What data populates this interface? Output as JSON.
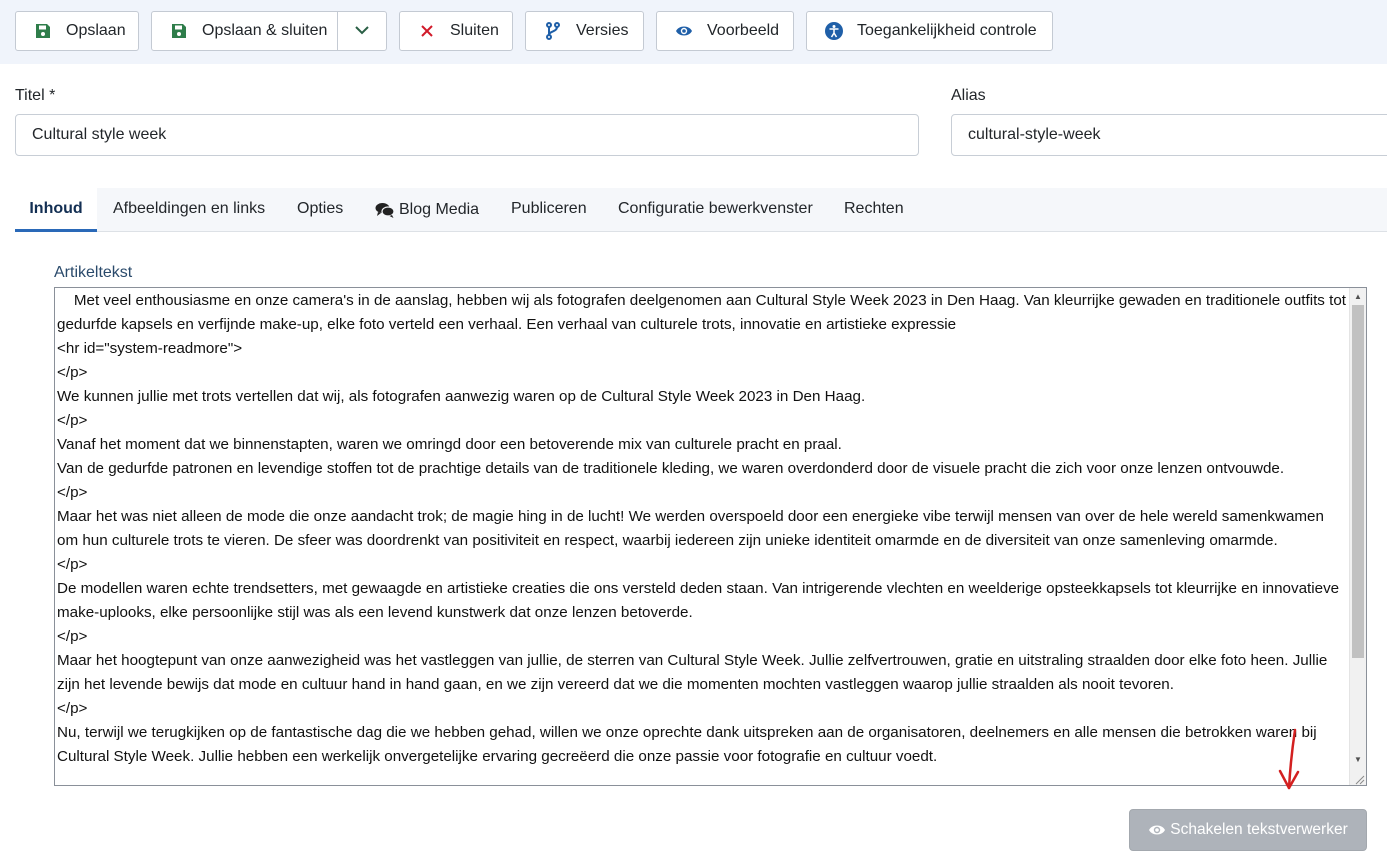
{
  "toolbar": {
    "save": "Opslaan",
    "save_close": "Opslaan & sluiten",
    "close": "Sluiten",
    "versions": "Versies",
    "preview": "Voorbeeld",
    "accessibility": "Toegankelijkheid controle"
  },
  "form": {
    "title_label": "Titel *",
    "title_value": "Cultural style week",
    "alias_label": "Alias",
    "alias_value": "cultural-style-week"
  },
  "tabs": [
    {
      "label": "Inhoud",
      "active": true
    },
    {
      "label": "Afbeeldingen en links"
    },
    {
      "label": "Opties"
    },
    {
      "label": "Blog Media"
    },
    {
      "label": "Publiceren"
    },
    {
      "label": "Configuratie bewerkvenster"
    },
    {
      "label": "Rechten"
    }
  ],
  "editor": {
    "label": "Artikeltekst",
    "content": "    Met veel enthousiasme en onze camera's in de aanslag, hebben wij als fotografen deelgenomen aan Cultural Style Week 2023 in Den Haag. Van kleurrijke gewaden en traditionele outfits tot gedurfde kapsels en verfijnde make-up, elke foto verteld een verhaal. Een verhaal van culturele trots, innovatie en artistieke expressie\n<hr id=\"system-readmore\">\n</p>\nWe kunnen jullie met trots vertellen dat wij, als fotografen aanwezig waren op de Cultural Style Week 2023 in Den Haag.\n</p>\nVanaf het moment dat we binnenstapten, waren we omringd door een betoverende mix van culturele pracht en praal.\nVan de gedurfde patronen en levendige stoffen tot de prachtige details van de traditionele kleding, we waren overdonderd door de visuele pracht die zich voor onze lenzen ontvouwde.\n</p>\nMaar het was niet alleen de mode die onze aandacht trok; de magie hing in de lucht! We werden overspoeld door een energieke vibe terwijl mensen van over de hele wereld samenkwamen om hun culturele trots te vieren. De sfeer was doordrenkt van positiviteit en respect, waarbij iedereen zijn unieke identiteit omarmde en de diversiteit van onze samenleving omarmde.\n</p>\nDe modellen waren echte trendsetters, met gewaagde en artistieke creaties die ons versteld deden staan. Van intrigerende vlechten en weelderige opsteekkapsels tot kleurrijke en innovatieve make-uplooks, elke persoonlijke stijl was als een levend kunstwerk dat onze lenzen betoverde.\n</p>\nMaar het hoogtepunt van onze aanwezigheid was het vastleggen van jullie, de sterren van Cultural Style Week. Jullie zelfvertrouwen, gratie en uitstraling straalden door elke foto heen. Jullie zijn het levende bewijs dat mode en cultuur hand in hand gaan, en we zijn vereerd dat we die momenten mochten vastleggen waarop jullie straalden als nooit tevoren.\n</p>\nNu, terwijl we terugkijken op de fantastische dag die we hebben gehad, willen we onze oprechte dank uitspreken aan de organisatoren, deelnemers en alle mensen die betrokken waren bij Cultural Style Week. Jullie hebben een werkelijk onvergetelijke ervaring gecreëerd die onze passie voor fotografie en cultuur voedt."
  },
  "toggle_editor": "Schakelen tekstverwerker",
  "colors": {
    "save_icon": "#2e7d4a",
    "close_icon": "#d11a2a",
    "blue_icon": "#1f5fa8",
    "annotation": "#d32020"
  }
}
